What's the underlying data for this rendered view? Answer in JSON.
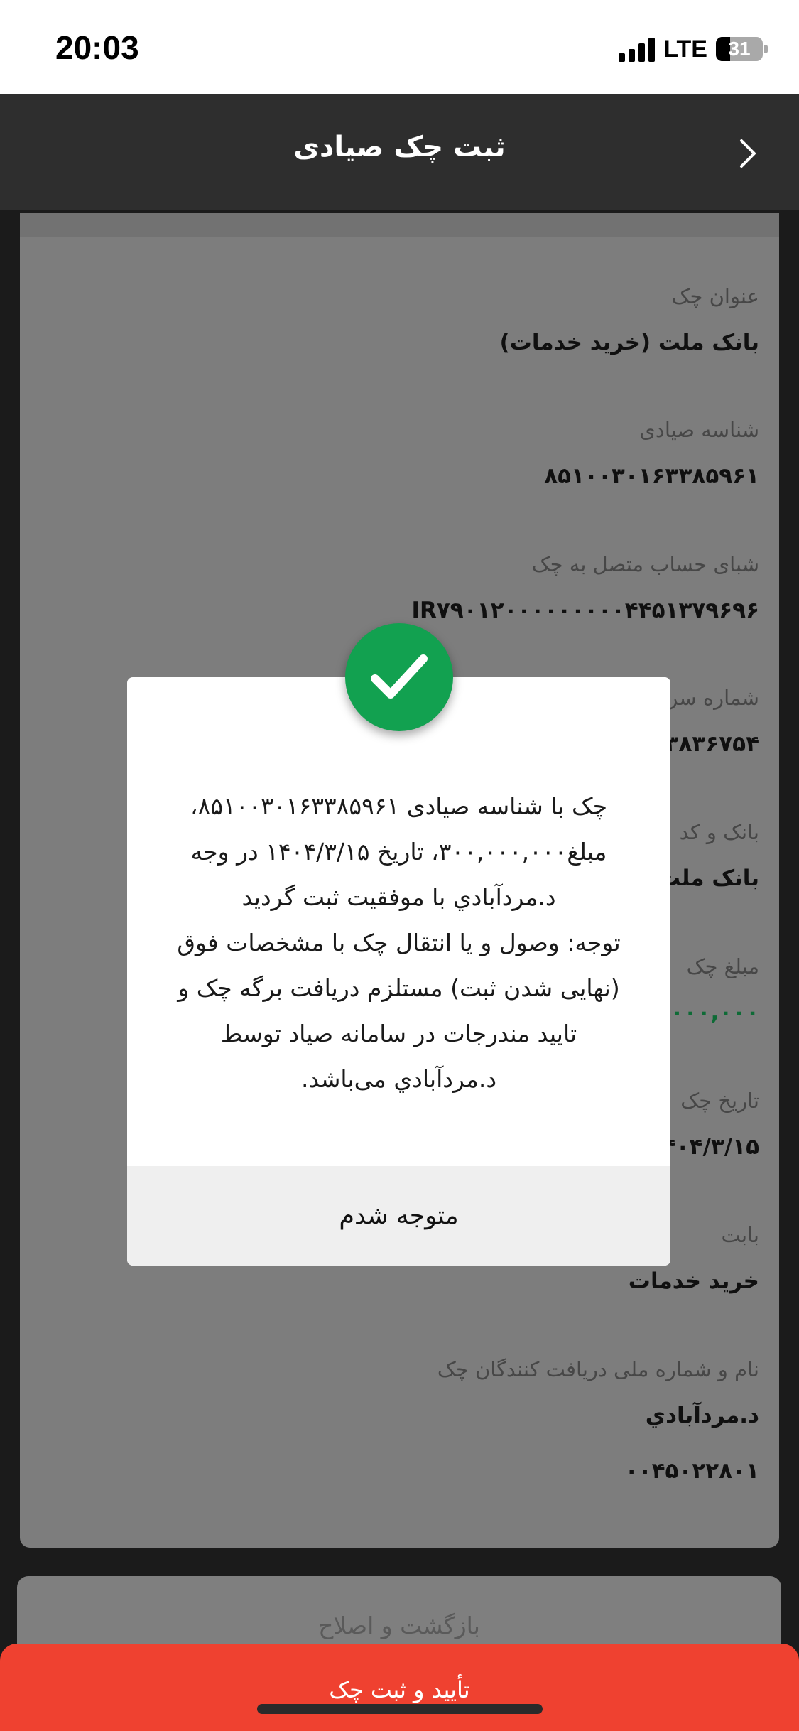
{
  "status_bar": {
    "time": "20:03",
    "network": "LTE",
    "battery_percent": "31",
    "battery_level": 0.31,
    "signal_bars": 4
  },
  "header": {
    "title": "ثبت چک صیادی",
    "back_icon": "chevron-right-icon"
  },
  "fields": [
    {
      "label": "عنوان چک",
      "value": "بانک ملت (خرید خدمات)"
    },
    {
      "label": "شناسه صیادی",
      "value": "۸۵۱۰۰۳۰۱۶۳۳۸۵۹۶۱"
    },
    {
      "label": "شبای حساب متصل به چک",
      "value": "IR۷۹۰۱۲۰۰۰۰۰۰۰۰۰۴۴۵۱۳۷۹۶۹۶"
    },
    {
      "label": "شماره سریال",
      "value": "۳۸۳۶۷۵۴"
    },
    {
      "label": "بانک و کد",
      "value": "بانک ملت"
    },
    {
      "label": "مبلغ چک",
      "value": "۳۰۰,۰۰۰,۰۰۰"
    },
    {
      "label": "تاریخ چک",
      "value": "۱۴۰۴/۳/۱۵"
    },
    {
      "label": "بابت",
      "value": "خرید خدمات"
    },
    {
      "label": "نام و شماره ملی دریافت کنندگان چک",
      "value": "د.مردآبادي",
      "value2": "۰۰۴۵۰۲۲۸۰۱"
    }
  ],
  "dialog": {
    "icon": "checkmark-icon",
    "message": "چک با شناسه صیادی ۸۵۱۰۰۳۰۱۶۳۳۸۵۹۶۱،\nمبلغ۳۰۰,۰۰۰,۰۰۰، تاریخ ۱۴۰۴/۳/۱۵ در وجه\nد.مردآبادي با موفقیت ثبت گردید\nتوجه: وصول و یا انتقال چک با مشخصات فوق\n(نهایی شدن ثبت) مستلزم دریافت برگه چک و\nتایید مندرجات در سامانه صیاد توسط\nد.مردآبادي می‌باشد.",
    "button_label": "متوجه شدم"
  },
  "buttons": {
    "back_label": "بازگشت و اصلاح",
    "confirm_label": "تأیید و ثبت چک"
  },
  "colors": {
    "confirm": "#ef4130",
    "success": "#12a150",
    "header": "#2e2e2e"
  }
}
